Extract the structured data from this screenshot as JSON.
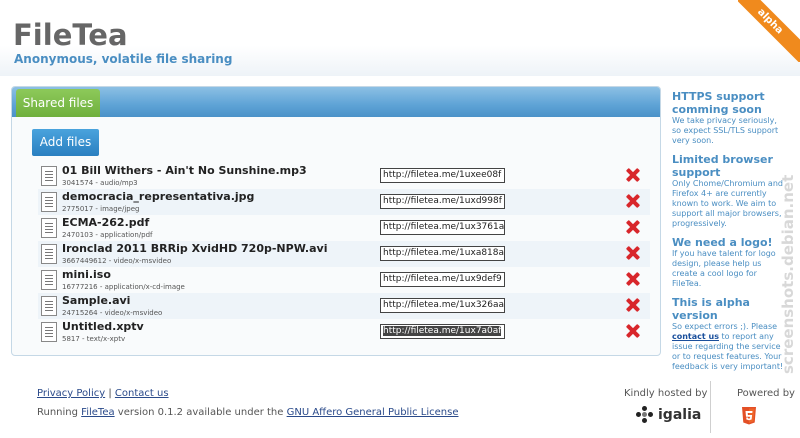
{
  "header": {
    "title": "FileTea",
    "tagline": "Anonymous, volatile file sharing",
    "ribbon": "alpha"
  },
  "panel": {
    "tab_label": "Shared files",
    "add_button_label": "Add files"
  },
  "files": [
    {
      "name": "01 Bill Withers - Ain't No Sunshine.mp3",
      "meta": "3041574 - audio/mp3",
      "url": "http://filetea.me/1uxee08f"
    },
    {
      "name": "democracia_representativa.jpg",
      "meta": "2775017 - image/jpeg",
      "url": "http://filetea.me/1uxd998f"
    },
    {
      "name": "ECMA-262.pdf",
      "meta": "2470103 - application/pdf",
      "url": "http://filetea.me/1ux3761a"
    },
    {
      "name": "Ironclad 2011 BRRip XvidHD 720p-NPW.avi",
      "meta": "3667449612 - video/x-msvideo",
      "url": "http://filetea.me/1uxa818a"
    },
    {
      "name": "mini.iso",
      "meta": "16777216 - application/x-cd-image",
      "url": "http://filetea.me/1ux9def9"
    },
    {
      "name": "Sample.avi",
      "meta": "24715264 - video/x-msvideo",
      "url": "http://filetea.me/1ux326aa"
    },
    {
      "name": "Untitled.xptv",
      "meta": "5817 - text/x-xptv",
      "url": "http://filetea.me/1ux7a0af"
    }
  ],
  "sidebar": {
    "https_title": "HTTPS support comming soon",
    "https_text": "We take privacy seriously, so expect SSL/TLS support very soon.",
    "browser_title": "Limited browser support",
    "browser_text": "Only Chome/Chromium and Firefox 4+ are currently known to work. We aim to support all major browsers, progressively.",
    "logo_title": "We need a logo!",
    "logo_text": "If you have talent for logo design, please help us create a cool logo for FileTea.",
    "alpha_title": "This is alpha version",
    "alpha_text_1": "So expect errors ;). Please",
    "alpha_link": "contact us",
    "alpha_text_2": "to report any issue regarding the service or to request features. Your feedback is very important!"
  },
  "watermark": "screenshots.debian.net",
  "footer": {
    "privacy": "Privacy Policy",
    "separator": "|",
    "contact": "Contact us",
    "running": "Running",
    "app_link": "FileTea",
    "version_text": "version 0.1.2 available under the",
    "license": "GNU Affero General Public License",
    "hosted_by": "Kindly hosted by",
    "igalia": "igalia",
    "powered_by": "Powered by"
  },
  "colors": {
    "accent": "#4a8ec2",
    "tab_green": "#6fb03d",
    "delete_red": "#d8262b",
    "ribbon_orange": "#f08a1d"
  }
}
